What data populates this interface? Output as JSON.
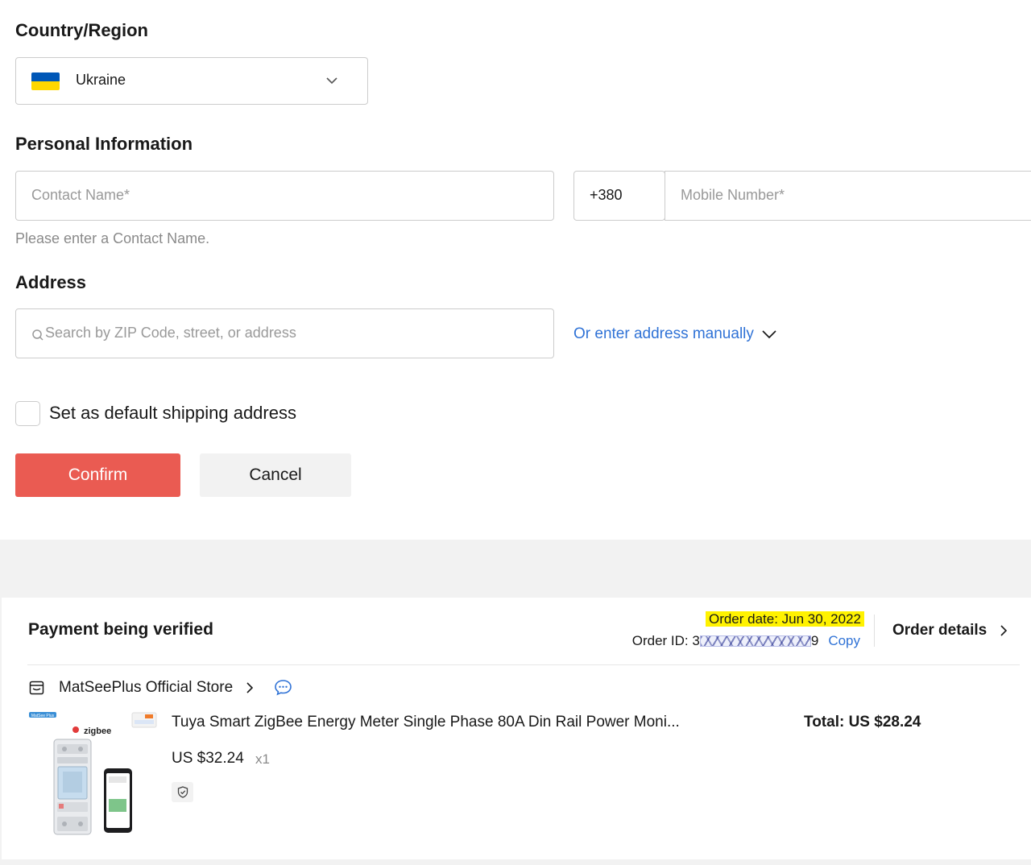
{
  "country_section": {
    "title": "Country/Region",
    "selected_country": "Ukraine"
  },
  "personal_section": {
    "title": "Personal Information",
    "contact_name_placeholder": "Contact Name*",
    "phone_code": "+380",
    "mobile_placeholder": "Mobile Number*",
    "contact_error": "Please enter a Contact Name."
  },
  "address_section": {
    "title": "Address",
    "search_placeholder": "Search by ZIP Code, street, or address",
    "manual_link": "Or enter address manually"
  },
  "default_checkbox": {
    "label": "Set as default shipping address",
    "checked": false
  },
  "buttons": {
    "confirm": "Confirm",
    "cancel": "Cancel"
  },
  "order": {
    "status": "Payment being verified",
    "order_date": "Order date: Jun 30, 2022",
    "order_id_prefix": "Order ID: 3",
    "order_id_suffix": "9",
    "copy_label": "Copy",
    "details_label": "Order details",
    "store_name": "MatSeePlus Official Store",
    "product_title": "Tuya Smart ZigBee Energy Meter Single Phase 80A Din Rail Power Moni...",
    "product_price": "US $32.24",
    "quantity": "x1",
    "total": "Total: US $28.24",
    "image_badge": "MatSee Plus",
    "image_brand": "zigbee"
  },
  "colors": {
    "confirm_bg": "#ea5b52",
    "link": "#2f72d6",
    "highlight": "#fff200",
    "flag_blue": "#0057b7",
    "flag_yellow": "#ffd700"
  }
}
